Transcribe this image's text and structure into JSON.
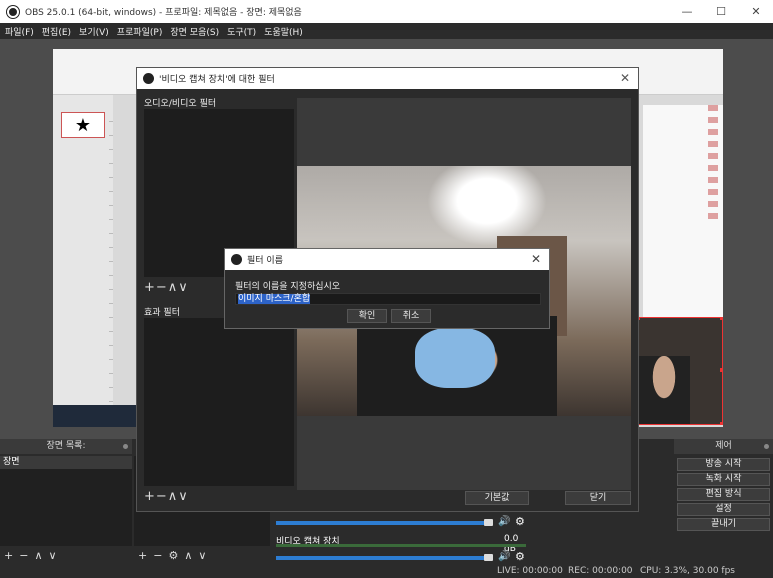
{
  "window": {
    "title": "OBS 25.0.1 (64-bit, windows) - 프로파일: 제목없음 - 장면: 제목없음",
    "minimize": "—",
    "maximize": "☐",
    "close": "✕"
  },
  "menu": [
    "파일(F)",
    "편집(E)",
    "보기(V)",
    "프로파일(P)",
    "장면 모음(S)",
    "도구(T)",
    "도움말(H)"
  ],
  "preview": {
    "slide_symbol": "★"
  },
  "scenes_dock": {
    "title": "장면 목록:",
    "items": [
      "장면"
    ],
    "footer": [
      "+",
      "−",
      "∧",
      "∨"
    ]
  },
  "sources_dock": {
    "footer": [
      "+",
      "−",
      "⚙",
      "∧",
      "∨"
    ]
  },
  "mixer": {
    "source_name": "비디오 캡쳐 장치",
    "level": "0.0 dB",
    "speaker_icon": "🔊",
    "gear_icon": "⚙"
  },
  "controls": {
    "title": "제어",
    "buttons": [
      "방송 시작",
      "녹화 시작",
      "편집 방식",
      "설정",
      "끝내기"
    ]
  },
  "status": {
    "live": "LIVE: 00:00:00",
    "rec": "REC: 00:00:00",
    "cpu": "CPU: 3.3%, 30.00 fps"
  },
  "filter_window": {
    "title": "'비디오 캡쳐 장치'에 대한 필터",
    "close": "✕",
    "av_filters_label": "오디오/비디오 필터",
    "effect_filters_label": "효과 필터",
    "list_controls": "+−∧∨",
    "defaults_button": "기본값",
    "close_button": "닫기"
  },
  "name_dialog": {
    "title": "필터 이름",
    "close": "✕",
    "prompt": "필터의 이름을 지정하십시오",
    "value": "이미지 마스크/혼합",
    "ok": "확인",
    "cancel": "취소"
  }
}
